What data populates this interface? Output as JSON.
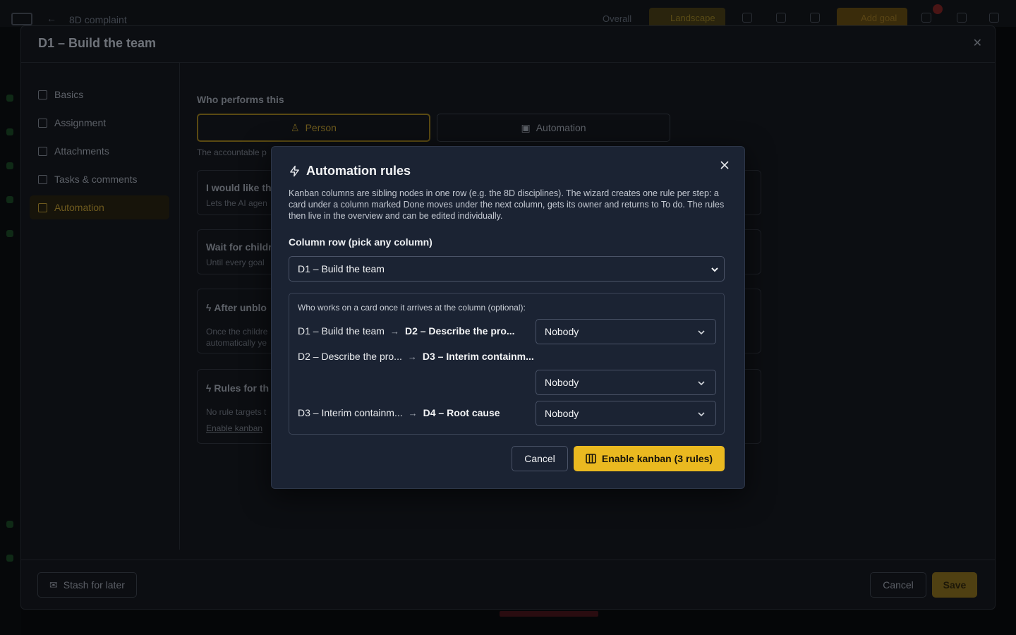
{
  "app": {
    "breadcrumb": "8D complaint",
    "toggle_overall": "Overall",
    "toggle_landscape": "Landscape",
    "add_goal": "Add goal"
  },
  "panel": {
    "title": "D1 – Build the team",
    "sidebar": [
      {
        "label": "Basics",
        "icon": "grid-icon"
      },
      {
        "label": "Assignment",
        "icon": "calendar-icon"
      },
      {
        "label": "Attachments",
        "icon": "paperclip-icon"
      },
      {
        "label": "Tasks & comments",
        "icon": "checklist-icon"
      },
      {
        "label": "Automation",
        "icon": "robot-icon",
        "active": true
      }
    ],
    "who_label": "Who performs this",
    "person": "Person",
    "automation": "Automation",
    "hint": "The accountable p",
    "cards": [
      {
        "title": "I would like th",
        "sub": "Lets the AI agen"
      },
      {
        "title": "Wait for childr",
        "sub": "Until every goal"
      },
      {
        "title": "After unblo",
        "sub": "Once the childre",
        "sub2": "automatically ye"
      },
      {
        "title": "Rules for th",
        "sub": "No rule targets t",
        "link": "Enable kanban"
      }
    ],
    "footer": {
      "stash": "Stash for later",
      "cancel": "Cancel",
      "save": "Save"
    }
  },
  "modal": {
    "title": "Automation rules",
    "description": "Kanban columns are sibling nodes in one row (e.g. the 8D disciplines). The wizard creates one rule per step: a card under a column marked Done moves under the next column, gets its owner and returns to To do. The rules then live in the overview and can be edited individually.",
    "column_label": "Column row (pick any column)",
    "column_selected": "D1 – Build the team",
    "box_label": "Who works on a card once it arrives at the column (optional):",
    "steps": [
      {
        "from": "D1 – Build the team",
        "to": "D2 – Describe the pro...",
        "owner": "Nobody"
      },
      {
        "from": "D2 – Describe the pro...",
        "to": "D3 – Interim containm...",
        "owner": "Nobody"
      },
      {
        "from": "D3 – Interim containm...",
        "to": "D4 – Root cause",
        "owner": "Nobody"
      }
    ],
    "cancel": "Cancel",
    "enable": "Enable kanban (3 rules)",
    "colors": {
      "accent": "#eab920",
      "surface": "#1b2333",
      "border": "#4a5367"
    }
  }
}
